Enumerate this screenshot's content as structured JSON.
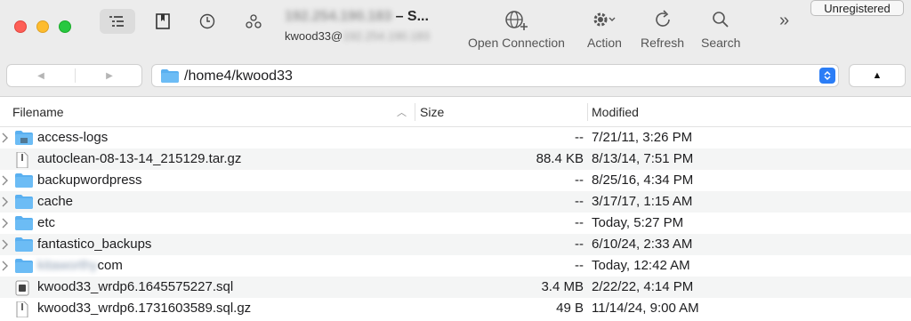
{
  "window": {
    "title_host": "192.254.190.183",
    "title_suffix": "– S...",
    "subtitle_user": "kwood33@",
    "subtitle_host": "192.254.190.183"
  },
  "toolbar": {
    "open_connection": "Open Connection",
    "action": "Action",
    "refresh": "Refresh",
    "search": "Search",
    "more": "»",
    "badge": "Unregistered"
  },
  "navigation": {
    "back_glyph": "◀",
    "forward_glyph": "▶",
    "path": "/home4/kwood33",
    "up_glyph": "▲"
  },
  "columns": {
    "filename": "Filename",
    "size": "Size",
    "modified": "Modified"
  },
  "files": [
    {
      "name": "access-logs",
      "type": "folder",
      "size": "--",
      "modified": "7/21/11, 3:26 PM"
    },
    {
      "name": "autoclean-08-13-14_215129.tar.gz",
      "type": "file",
      "size": "88.4 KB",
      "modified": "8/13/14, 7:51 PM"
    },
    {
      "name": "backupwordpress",
      "type": "folder",
      "size": "--",
      "modified": "8/25/16, 4:34 PM"
    },
    {
      "name": "cache",
      "type": "folder",
      "size": "--",
      "modified": "3/17/17, 1:15 AM"
    },
    {
      "name": "etc",
      "type": "folder",
      "size": "--",
      "modified": "Today, 5:27 PM"
    },
    {
      "name": "fantastico_backups",
      "type": "folder",
      "size": "--",
      "modified": "6/10/24, 2:33 AM"
    },
    {
      "name_blurred": "kitaworthy",
      "name_suffix": "com",
      "type": "folder",
      "size": "--",
      "modified": "Today, 12:42 AM"
    },
    {
      "name": "kwood33_wrdp6.1645575227.sql",
      "type": "sql",
      "size": "3.4 MB",
      "modified": "2/22/22, 4:14 PM"
    },
    {
      "name": "kwood33_wrdp6.1731603589.sql.gz",
      "type": "file",
      "size": "49 B",
      "modified": "11/14/24, 9:00 AM"
    }
  ],
  "colors": {
    "folder": "#5ab0f0",
    "accent": "#2b7df6",
    "toolbar_bg": "#ececec",
    "alt_row": "#f4f5f5"
  }
}
